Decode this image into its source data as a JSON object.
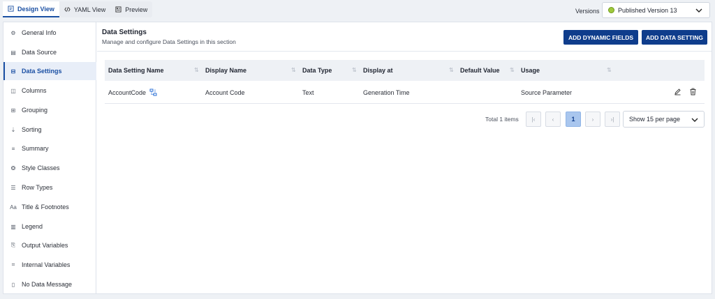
{
  "view_tabs": [
    {
      "label": "Design View",
      "icon": "design-icon",
      "active": true
    },
    {
      "label": "YAML View",
      "icon": "code-icon",
      "active": false
    },
    {
      "label": "Preview",
      "icon": "preview-icon",
      "active": false
    }
  ],
  "versions": {
    "label": "Versions",
    "selected": "Published Version 13",
    "status_color": "#9fc93c"
  },
  "sidebar": {
    "items": [
      {
        "label": "General Info",
        "icon": "gear-icon"
      },
      {
        "label": "Data Source",
        "icon": "data-source-icon"
      },
      {
        "label": "Data Settings",
        "icon": "data-settings-icon",
        "active": true
      },
      {
        "label": "Columns",
        "icon": "columns-icon"
      },
      {
        "label": "Grouping",
        "icon": "grouping-icon"
      },
      {
        "label": "Sorting",
        "icon": "sort-icon"
      },
      {
        "label": "Summary",
        "icon": "summary-icon"
      },
      {
        "label": "Style Classes",
        "icon": "palette-icon"
      },
      {
        "label": "Row Types",
        "icon": "row-types-icon"
      },
      {
        "label": "Title & Footnotes",
        "icon": "text-icon"
      },
      {
        "label": "Legend",
        "icon": "legend-icon"
      },
      {
        "label": "Output Variables",
        "icon": "output-icon"
      },
      {
        "label": "Internal Variables",
        "icon": "internal-icon"
      },
      {
        "label": "No Data Message",
        "icon": "message-icon"
      }
    ]
  },
  "main": {
    "title": "Data Settings",
    "subtitle": "Manage and configure Data Settings in this section",
    "add_dynamic_label": "ADD DYNAMIC FIELDS",
    "add_data_label": "ADD DATA SETTING"
  },
  "table": {
    "columns": [
      "Data Setting Name",
      "Display Name",
      "Data Type",
      "Display at",
      "Default Value",
      "Usage"
    ],
    "rows": [
      {
        "name": "AccountCode",
        "display_name": "Account Code",
        "data_type": "Text",
        "display_at": "Generation Time",
        "default_value": "",
        "usage": "Source Parameter"
      }
    ]
  },
  "pagination": {
    "total": "Total 1 items",
    "current_page": "1",
    "per_page": "Show 15 per page"
  },
  "colors": {
    "accent": "#1a4fa3",
    "button": "#0f3d8c"
  }
}
